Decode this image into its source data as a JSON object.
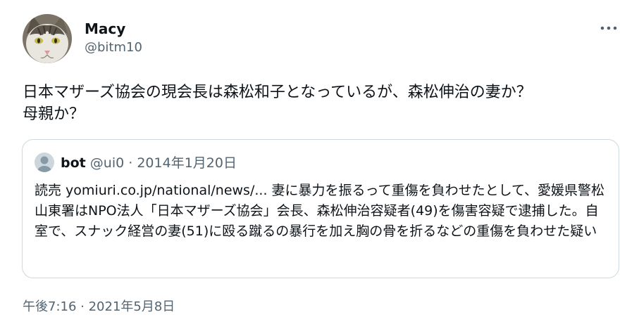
{
  "author": {
    "name": "Macy",
    "handle": "@bitm10",
    "avatar_icon": "cat-avatar-icon"
  },
  "more_icon": "more-horizontal-icon",
  "tweet": {
    "text": "日本マザーズ協会の現会長は森松和子となっているが、森松伸治の妻か？\n母親か？"
  },
  "quote": {
    "name": "bot",
    "handle": "@ui0",
    "separator": " · ",
    "date": "2014年1月20日",
    "avatar_icon": "default-user-avatar-icon",
    "text": "読売 yomiuri.co.jp/national/news/... 妻に暴力を振るって重傷を負わせたとして、愛媛県警松山東署はNPO法人「日本マザーズ協会」会長、森松伸治容疑者(49)を傷害容疑で逮捕した。自室で、スナック経営の妻(51)に殴る蹴るの暴行を加え胸の骨を折るなどの重傷を負わせた疑い"
  },
  "timestamp": {
    "time": "午後7:16",
    "separator": " · ",
    "date": "2021年5月8日"
  },
  "colors": {
    "text": "#0f1419",
    "secondary": "#536471",
    "border": "#cfd9de"
  }
}
